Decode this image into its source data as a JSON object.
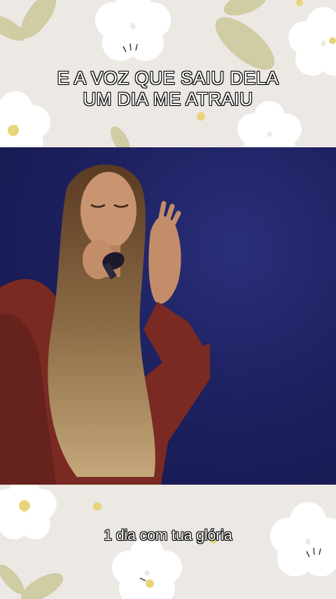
{
  "background": {
    "color": "#ece8e4",
    "pattern": "white-daisies-and-green-leaves"
  },
  "top_caption": {
    "line1": "E A VOZ QUE SAIU DELA",
    "line2": "UM DIA ME ATRAIU"
  },
  "video": {
    "subject": "singer-with-microphone",
    "backdrop_color": "#1d2160"
  },
  "bottom_caption": {
    "text": "1 dia com tua glória"
  },
  "colors": {
    "leaf": "#c9c79a",
    "flower": "#ffffff",
    "flower_center": "#e8d57a",
    "jacket": "#7a2a22"
  }
}
